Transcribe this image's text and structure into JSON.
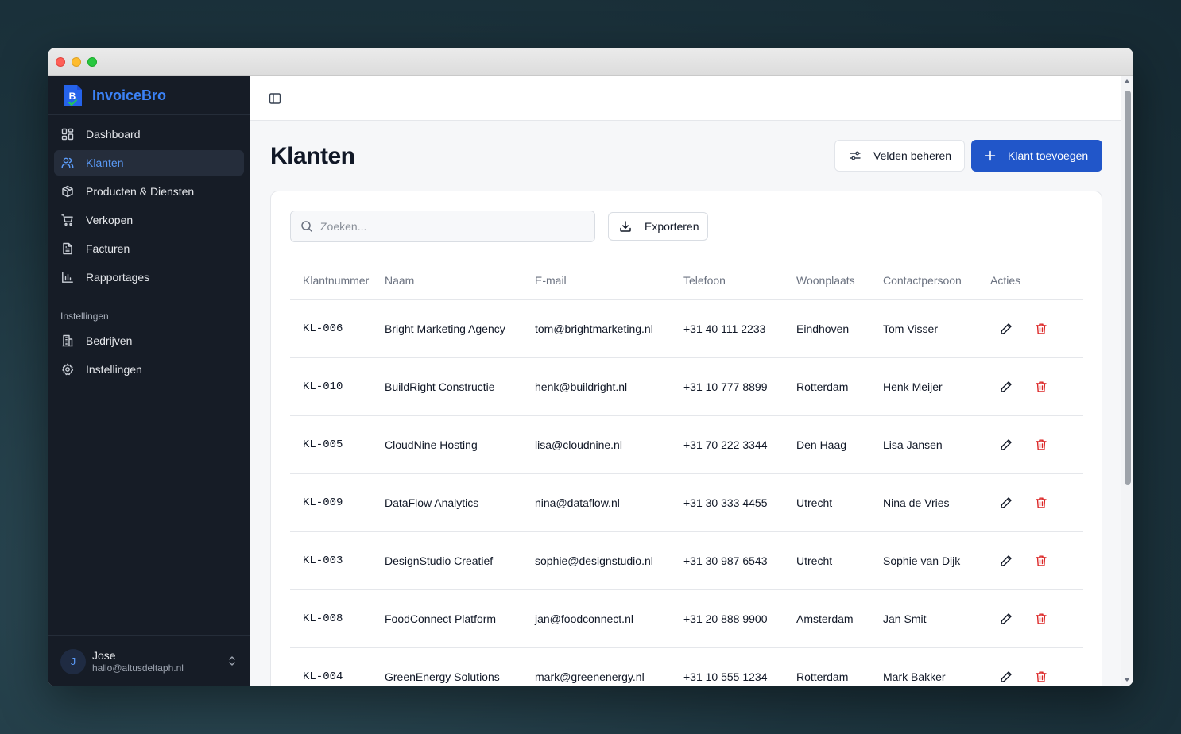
{
  "app": {
    "name": "InvoiceBro",
    "logo_letter": "B"
  },
  "sidebar": {
    "items": [
      {
        "label": "Dashboard",
        "icon": "dashboard-icon"
      },
      {
        "label": "Klanten",
        "icon": "users-icon",
        "active": true
      },
      {
        "label": "Producten & Diensten",
        "icon": "package-icon"
      },
      {
        "label": "Verkopen",
        "icon": "cart-icon"
      },
      {
        "label": "Facturen",
        "icon": "file-text-icon"
      },
      {
        "label": "Rapportages",
        "icon": "bar-chart-icon"
      }
    ],
    "section_label": "Instellingen",
    "settings_items": [
      {
        "label": "Bedrijven",
        "icon": "building-icon"
      },
      {
        "label": "Instellingen",
        "icon": "gear-icon"
      }
    ],
    "user": {
      "initial": "J",
      "name": "Jose",
      "email": "hallo@altusdeltaph.nl"
    }
  },
  "page": {
    "title": "Klanten",
    "manage_fields_label": "Velden beheren",
    "add_client_label": "Klant toevoegen",
    "search_placeholder": "Zoeken...",
    "export_label": "Exporteren"
  },
  "table": {
    "columns": [
      "Klantnummer",
      "Naam",
      "E-mail",
      "Telefoon",
      "Woonplaats",
      "Contactpersoon",
      "Acties"
    ],
    "rows": [
      [
        "KL-006",
        "Bright Marketing Agency",
        "tom@brightmarketing.nl",
        "+31 40 111 2233",
        "Eindhoven",
        "Tom Visser"
      ],
      [
        "KL-010",
        "BuildRight Constructie",
        "henk@buildright.nl",
        "+31 10 777 8899",
        "Rotterdam",
        "Henk Meijer"
      ],
      [
        "KL-005",
        "CloudNine Hosting",
        "lisa@cloudnine.nl",
        "+31 70 222 3344",
        "Den Haag",
        "Lisa Jansen"
      ],
      [
        "KL-009",
        "DataFlow Analytics",
        "nina@dataflow.nl",
        "+31 30 333 4455",
        "Utrecht",
        "Nina de Vries"
      ],
      [
        "KL-003",
        "DesignStudio Creatief",
        "sophie@designstudio.nl",
        "+31 30 987 6543",
        "Utrecht",
        "Sophie van Dijk"
      ],
      [
        "KL-008",
        "FoodConnect Platform",
        "jan@foodconnect.nl",
        "+31 20 888 9900",
        "Amsterdam",
        "Jan Smit"
      ],
      [
        "KL-004",
        "GreenEnergy Solutions",
        "mark@greenenergy.nl",
        "+31 10 555 1234",
        "Rotterdam",
        "Mark Bakker"
      ]
    ]
  },
  "colors": {
    "sidebar_bg": "#161c26",
    "accent": "#3b82f6",
    "primary_button": "#2156c9",
    "danger": "#dc2626"
  }
}
